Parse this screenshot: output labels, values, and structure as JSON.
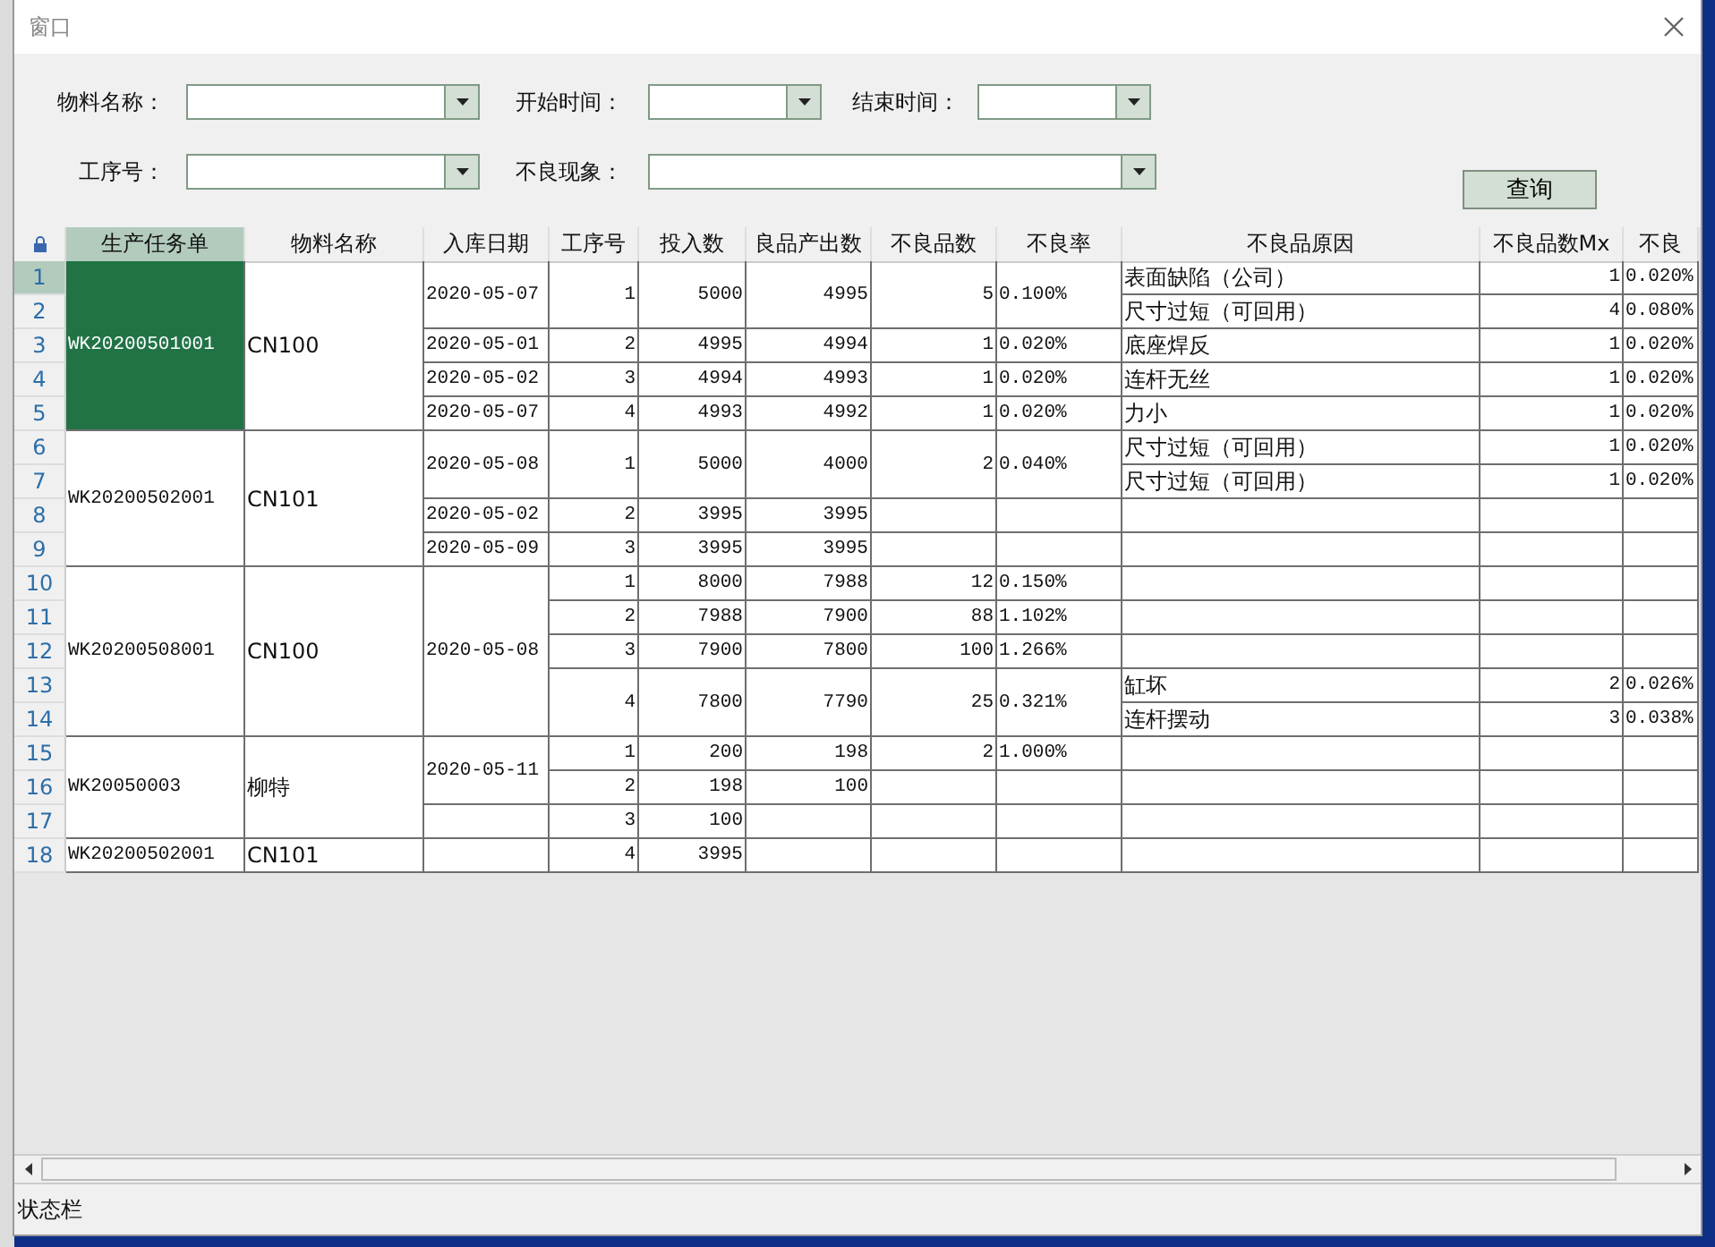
{
  "window": {
    "title": "窗口"
  },
  "filters": [
    {
      "label": "物料名称："
    },
    {
      "label": "开始时间："
    },
    {
      "label": "结束时间："
    },
    {
      "label": "工序号："
    },
    {
      "label": "不良现象："
    }
  ],
  "query_button": "查询",
  "table": {
    "columns": [
      {
        "label": "生产任务单",
        "selected": true
      },
      {
        "label": "物料名称",
        "selected": false
      },
      {
        "label": "入库日期",
        "selected": false
      },
      {
        "label": "工序号",
        "selected": false
      },
      {
        "label": "投入数",
        "selected": false
      },
      {
        "label": "良品产出数",
        "selected": false
      },
      {
        "label": "不良品数",
        "selected": false
      },
      {
        "label": "不良率",
        "selected": false
      },
      {
        "label": "不良品原因",
        "selected": false
      },
      {
        "label": "不良品数Mx",
        "selected": false
      },
      {
        "label": "不良",
        "selected": false
      }
    ],
    "row_headers": [
      {
        "label": "1",
        "selected": true
      },
      {
        "label": "2",
        "selected": false
      },
      {
        "label": "3",
        "selected": false
      },
      {
        "label": "4",
        "selected": false
      },
      {
        "label": "5",
        "selected": false
      },
      {
        "label": "6",
        "selected": false
      },
      {
        "label": "7",
        "selected": false
      },
      {
        "label": "8",
        "selected": false
      },
      {
        "label": "9",
        "selected": false
      },
      {
        "label": "10",
        "selected": false
      },
      {
        "label": "11",
        "selected": false
      },
      {
        "label": "12",
        "selected": false
      },
      {
        "label": "13",
        "selected": false
      },
      {
        "label": "14",
        "selected": false
      },
      {
        "label": "15",
        "selected": false
      },
      {
        "label": "16",
        "selected": false
      },
      {
        "label": "17",
        "selected": false
      },
      {
        "label": "18",
        "selected": false
      }
    ],
    "tasks": [
      {
        "task": "WK20200501001",
        "material": "CN100",
        "selected": true,
        "dates": [
          {
            "date": "2020-05-07",
            "steps": [
              {
                "step": "1",
                "input": "5000",
                "good": "4995",
                "defects": "5",
                "rate": "0.100%",
                "reasons": [
                  {
                    "reason": "表面缺陷（公司）",
                    "count": "1",
                    "rate": "0.020%"
                  },
                  {
                    "reason": "尺寸过短（可回用）",
                    "count": "4",
                    "rate": "0.080%"
                  }
                ]
              }
            ]
          },
          {
            "date": "2020-05-01",
            "steps": [
              {
                "step": "2",
                "input": "4995",
                "good": "4994",
                "defects": "1",
                "rate": "0.020%",
                "reasons": [
                  {
                    "reason": "底座焊反",
                    "count": "1",
                    "rate": "0.020%"
                  }
                ]
              }
            ]
          },
          {
            "date": "2020-05-02",
            "steps": [
              {
                "step": "3",
                "input": "4994",
                "good": "4993",
                "defects": "1",
                "rate": "0.020%",
                "reasons": [
                  {
                    "reason": "连杆无丝",
                    "count": "1",
                    "rate": "0.020%"
                  }
                ]
              }
            ]
          },
          {
            "date": "2020-05-07",
            "steps": [
              {
                "step": "4",
                "input": "4993",
                "good": "4992",
                "defects": "1",
                "rate": "0.020%",
                "reasons": [
                  {
                    "reason": "力小",
                    "count": "1",
                    "rate": "0.020%"
                  }
                ]
              }
            ]
          }
        ]
      },
      {
        "task": "WK20200502001",
        "material": "CN101",
        "selected": false,
        "dates": [
          {
            "date": "2020-05-08",
            "steps": [
              {
                "step": "1",
                "input": "5000",
                "good": "4000",
                "defects": "2",
                "rate": "0.040%",
                "reasons": [
                  {
                    "reason": "尺寸过短（可回用）",
                    "count": "1",
                    "rate": "0.020%"
                  },
                  {
                    "reason": "尺寸过短（可回用）",
                    "count": "1",
                    "rate": "0.020%"
                  }
                ]
              }
            ]
          },
          {
            "date": "2020-05-02",
            "steps": [
              {
                "step": "2",
                "input": "3995",
                "good": "3995"
              }
            ]
          },
          {
            "date": "2020-05-09",
            "steps": [
              {
                "step": "3",
                "input": "3995",
                "good": "3995"
              }
            ]
          }
        ]
      },
      {
        "task": "WK20200508001",
        "material": "CN100",
        "selected": false,
        "dates": [
          {
            "date": "2020-05-08",
            "steps": [
              {
                "step": "1",
                "input": "8000",
                "good": "7988",
                "defects": "12",
                "rate": "0.150%"
              },
              {
                "step": "2",
                "input": "7988",
                "good": "7900",
                "defects": "88",
                "rate": "1.102%"
              },
              {
                "step": "3",
                "input": "7900",
                "good": "7800",
                "defects": "100",
                "rate": "1.266%"
              },
              {
                "step": "4",
                "input": "7800",
                "good": "7790",
                "defects": "25",
                "rate": "0.321%",
                "reasons": [
                  {
                    "reason": "缸坏",
                    "count": "2",
                    "rate": "0.026%"
                  },
                  {
                    "reason": "连杆摆动",
                    "count": "3",
                    "rate": "0.038%"
                  }
                ]
              }
            ]
          }
        ]
      },
      {
        "task": "WK20050003",
        "material": "柳特",
        "selected": false,
        "dates": [
          {
            "date": "2020-05-11",
            "steps": [
              {
                "step": "1",
                "input": "200",
                "good": "198",
                "defects": "2",
                "rate": "1.000%"
              },
              {
                "step": "2",
                "input": "198",
                "good": "100"
              }
            ]
          },
          {
            "steps": [
              {
                "step": "3",
                "input": "100"
              }
            ]
          }
        ]
      },
      {
        "task": "WK20200502001",
        "material": "CN101",
        "selected": false,
        "dates": [
          {
            "steps": [
              {
                "step": "4",
                "input": "3995"
              }
            ]
          }
        ]
      }
    ]
  },
  "status_bar": "状态栏"
}
